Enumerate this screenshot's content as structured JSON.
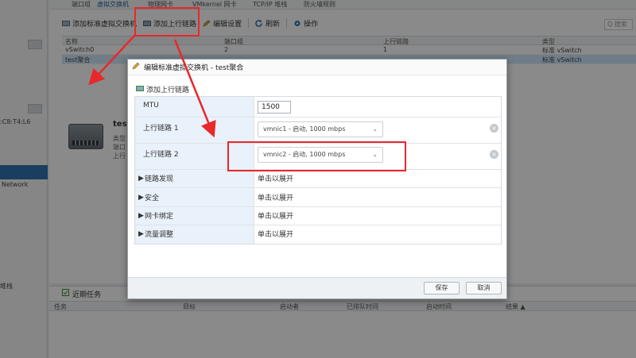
{
  "tabs": [
    "端口组",
    "虚拟交换机",
    "物理网卡",
    "VMkernel 网卡",
    "TCP/IP 堆栈",
    "防火墙规则"
  ],
  "left_pane": {
    "mac_fragment": ":C8:T4:L6",
    "network_label": "Network",
    "bottom_label": "堆栈"
  },
  "toolbar": {
    "add_vswitch": "添加标准虚拟交换机",
    "add_uplink": "添加上行链路",
    "edit_settings": "编辑设置",
    "refresh": "刷新",
    "actions": "操作",
    "search_placeholder": "Q 搜索"
  },
  "grid": {
    "headers": [
      "名称",
      "端口组",
      "上行链路",
      "类型"
    ],
    "rows": [
      {
        "name": "vSwitch0",
        "ports": "2",
        "uplinks": "1",
        "type": "标准 vSwitch"
      },
      {
        "name": "test聚合",
        "ports": "",
        "uplinks": "",
        "type": "标准 vSwitch"
      }
    ]
  },
  "detail": {
    "title": "test",
    "lines": [
      "类型",
      "端口",
      "上行"
    ]
  },
  "recent_tasks": {
    "title": "近期任务",
    "headers": [
      "任务",
      "目标",
      "启动者",
      "已排队时间",
      "启动时间",
      "结果 ▲"
    ]
  },
  "dialog": {
    "title": "编辑标准虚拟交换机 - test聚合",
    "add_uplink_link": "添加上行链路",
    "rows": {
      "mtu_label": "MTU",
      "mtu_value": "1500",
      "uplink1_label": "上行链路 1",
      "uplink1_value": "vmnic1 - 启动, 1000 mbps",
      "uplink2_label": "上行链路 2",
      "uplink2_value": "vmnic2 - 启动, 1000 mbps",
      "link_discovery_label": "链路发现",
      "link_discovery_value": "单击以展开",
      "security_label": "安全",
      "security_value": "单击以展开",
      "nic_teaming_label": "网卡绑定",
      "nic_teaming_value": "单击以展开",
      "traffic_shaping_label": "流量调整",
      "traffic_shaping_value": "单击以展开"
    },
    "save": "保存",
    "cancel": "取消"
  },
  "colors": {
    "annotation": "#e8282b",
    "selection": "#2e72ad",
    "label_bg": "#e9f1fa"
  }
}
